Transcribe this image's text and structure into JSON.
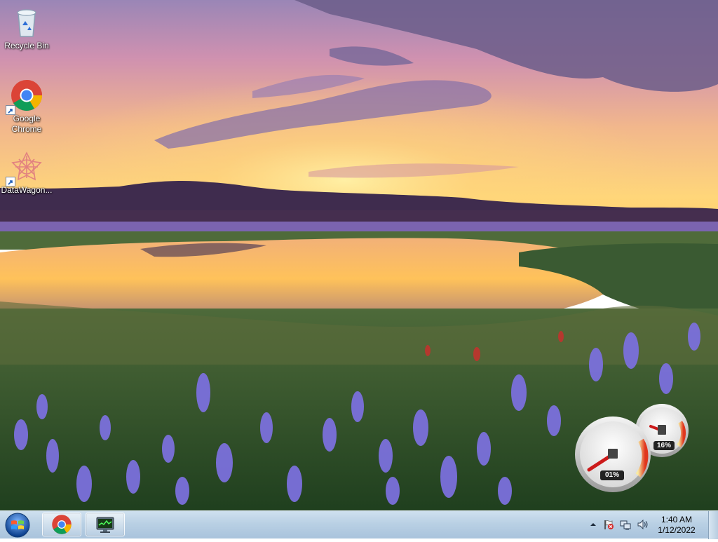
{
  "desktop": {
    "icons": [
      {
        "label": "Recycle Bin",
        "icon": "recycle-bin-icon"
      },
      {
        "label": "Google\nChrome",
        "label_line1": "Google",
        "label_line2": "Chrome",
        "icon": "chrome-icon"
      },
      {
        "label": "DataWagon...",
        "icon": "datawagon-icon"
      }
    ]
  },
  "gadget": {
    "cpu_label": "01%",
    "memory_label": "16%",
    "cpu_percent": 1,
    "memory_percent": 16
  },
  "taskbar": {
    "start_icon": "windows-logo-icon",
    "pinned": [
      {
        "name": "chrome",
        "icon": "chrome-icon"
      },
      {
        "name": "task-manager",
        "icon": "monitor-icon"
      }
    ],
    "tray": {
      "icons": [
        "show-hidden-icons-icon",
        "action-center-flag-icon",
        "network-icon",
        "volume-icon"
      ],
      "time": "1:40 AM",
      "date": "1/12/2022"
    }
  },
  "colors": {
    "taskbar_top": "#cfe0ef",
    "taskbar_bottom": "#a9c3dc",
    "sky_top": "#8f7fb0",
    "sunset_glow": "#ffd06a",
    "flowers": "#7a6fd8"
  }
}
